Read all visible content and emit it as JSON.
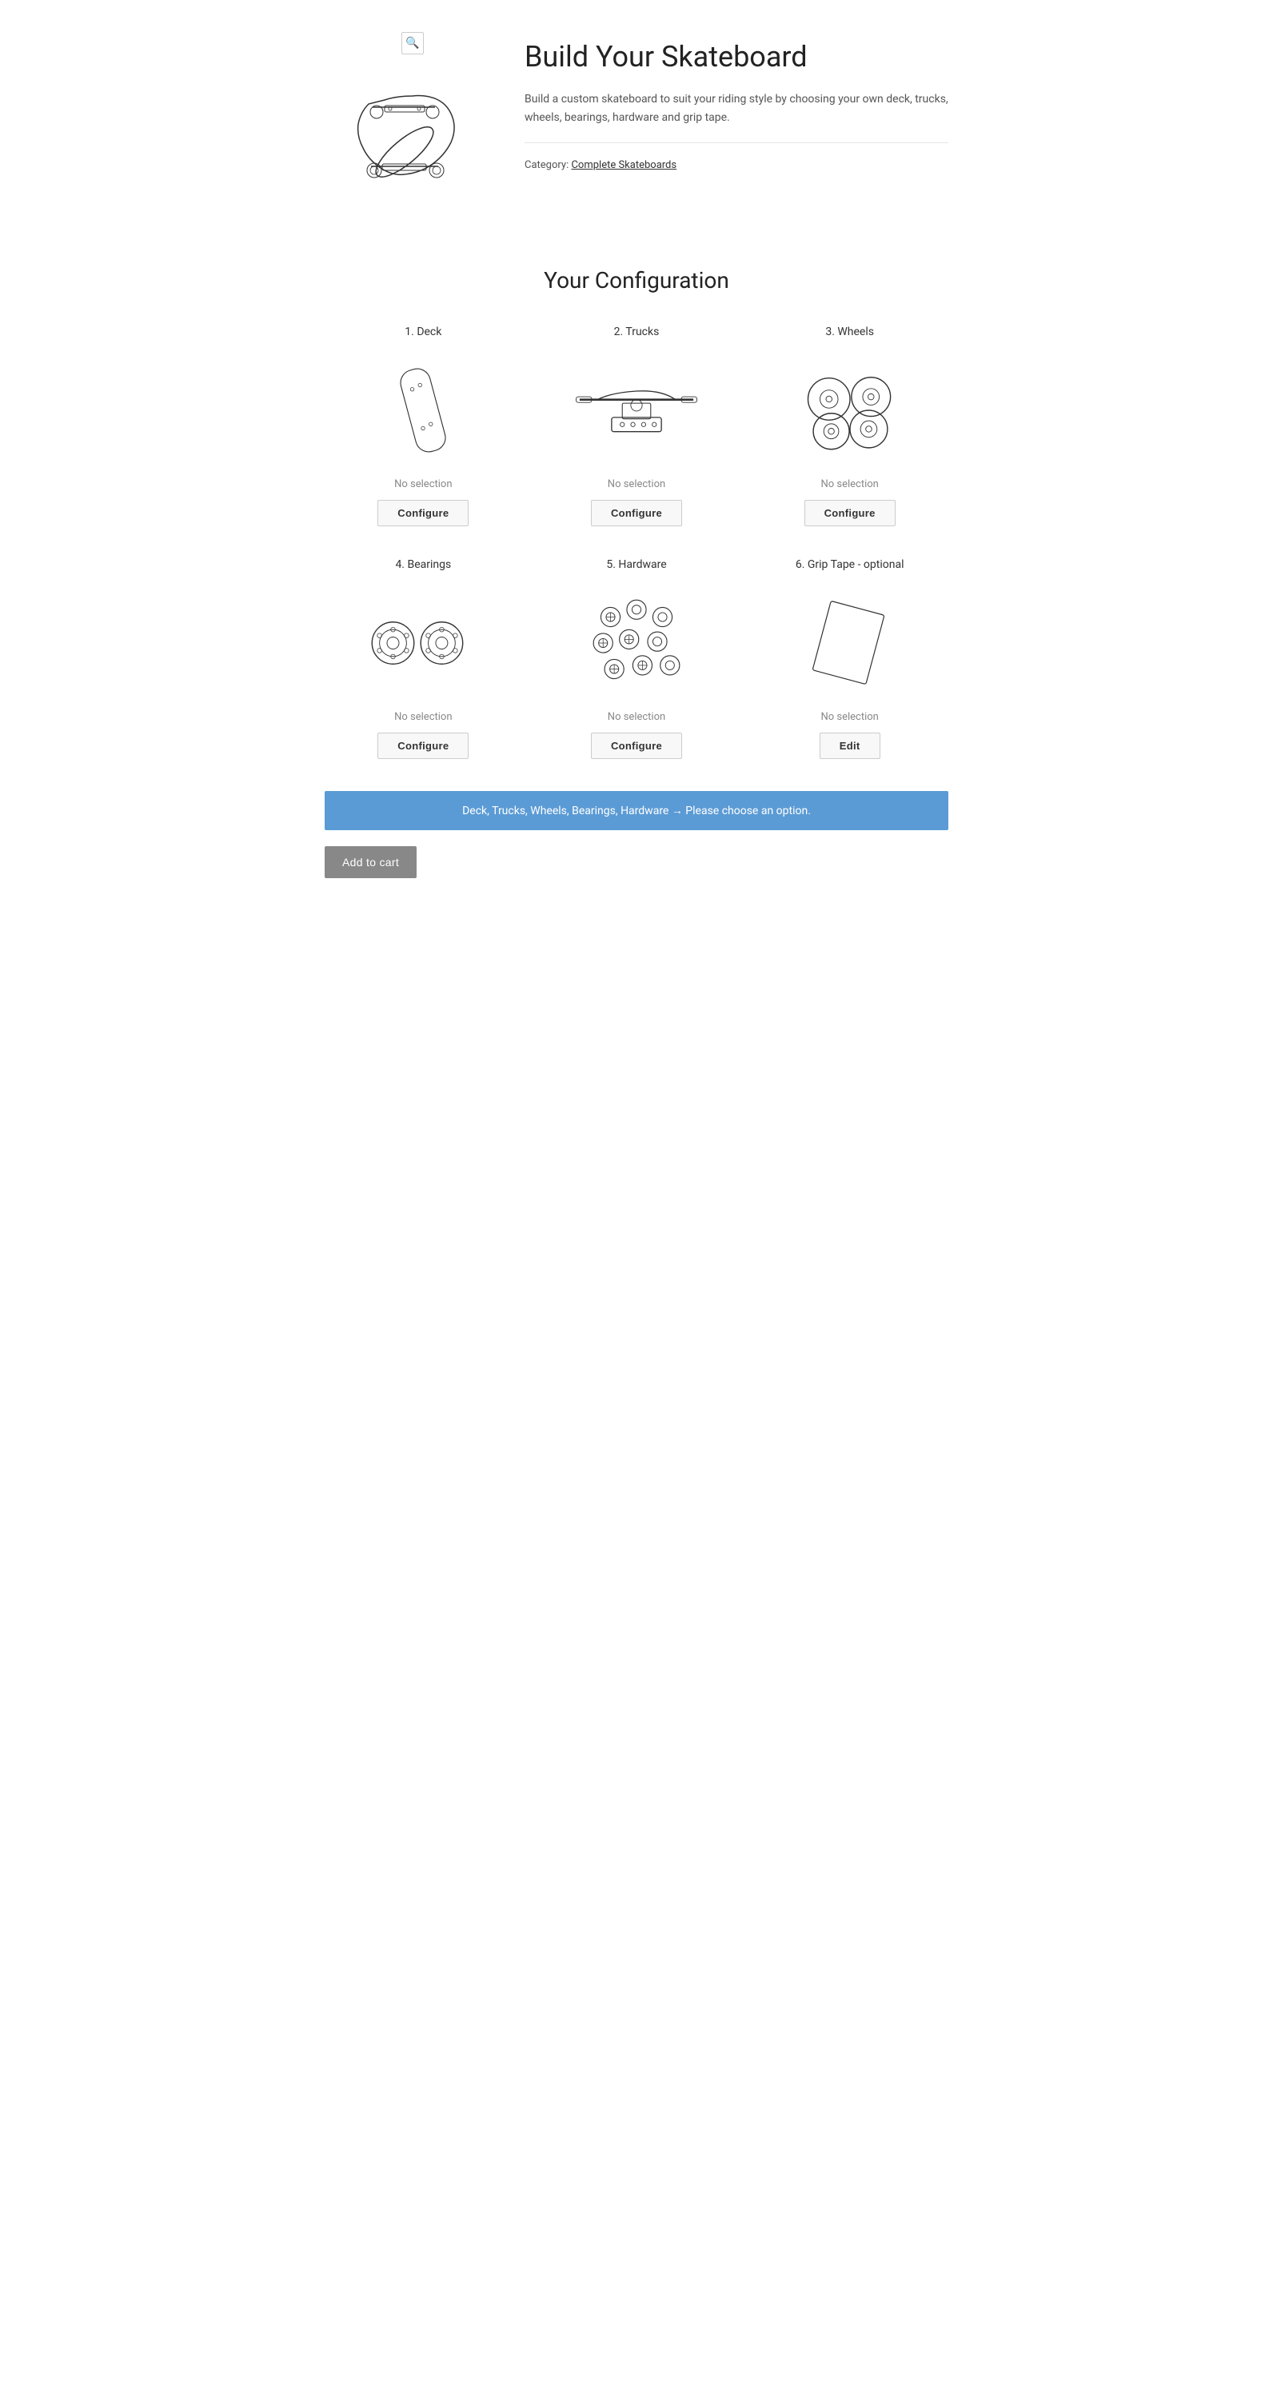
{
  "header": {
    "title": "Build Your Skateboard",
    "description": "Build a custom skateboard to suit your riding style by choosing your own deck, trucks, wheels, bearings, hardware and grip tape.",
    "category_label": "Category:",
    "category_link_text": "Complete Skateboards",
    "zoom_icon": "🔍"
  },
  "config_section": {
    "title": "Your Configuration"
  },
  "items": [
    {
      "id": "deck",
      "number": "1",
      "label": "1. Deck",
      "status": "No selection",
      "button_label": "Configure",
      "button_type": "configure"
    },
    {
      "id": "trucks",
      "number": "2",
      "label": "2. Trucks",
      "status": "No selection",
      "button_label": "Configure",
      "button_type": "configure"
    },
    {
      "id": "wheels",
      "number": "3",
      "label": "3. Wheels",
      "status": "No selection",
      "button_label": "Configure",
      "button_type": "configure"
    },
    {
      "id": "bearings",
      "number": "4",
      "label": "4. Bearings",
      "status": "No selection",
      "button_label": "Configure",
      "button_type": "configure"
    },
    {
      "id": "hardware",
      "number": "5",
      "label": "5. Hardware",
      "status": "No selection",
      "button_label": "Configure",
      "button_type": "configure"
    },
    {
      "id": "grip-tape",
      "number": "6",
      "label": "6. Grip Tape - optional",
      "status": "No selection",
      "button_label": "Edit",
      "button_type": "edit"
    }
  ],
  "alert": {
    "message": "Deck, Trucks, Wheels, Bearings, Hardware → Please choose an option."
  },
  "add_to_cart": {
    "label": "Add to cart"
  }
}
